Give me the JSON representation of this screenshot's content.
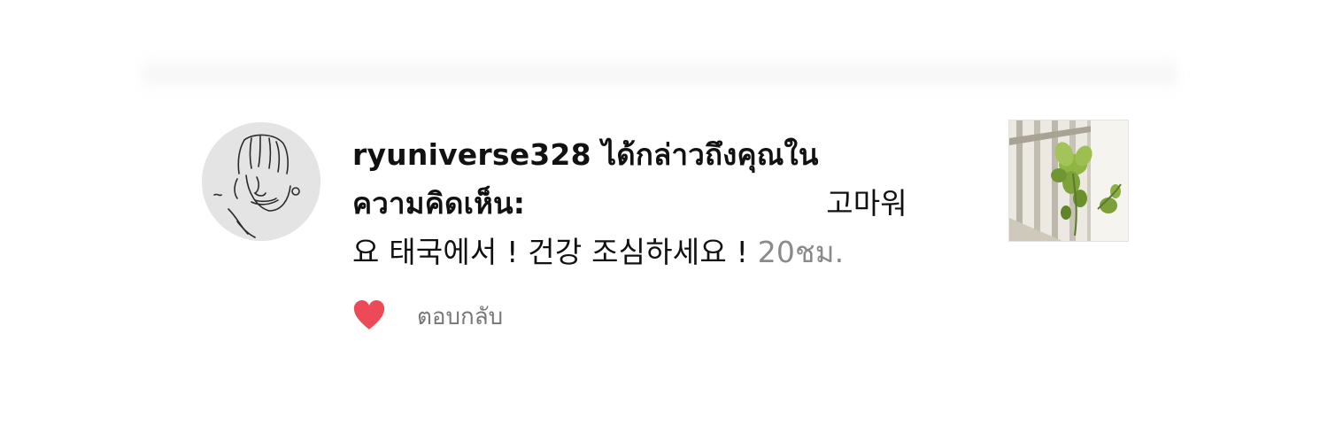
{
  "notification": {
    "username": "ryuniverse328",
    "mention_text_part1": " ได้กล่าวถึงคุณใน",
    "mention_text_part2": "ความคิดเห็น:",
    "comment_line1_end": "고마워",
    "comment_line2": "요 태국에서 ! 건강 조심하세요 ! ",
    "timestamp": "20ชม.",
    "reply_label": "ตอบกลับ"
  },
  "icons": {
    "like": "heart-icon",
    "avatar": "user-avatar",
    "thumbnail": "post-thumbnail"
  },
  "colors": {
    "heart": "#ed4956",
    "timestamp": "#8a8a8a",
    "reply": "#777777"
  }
}
